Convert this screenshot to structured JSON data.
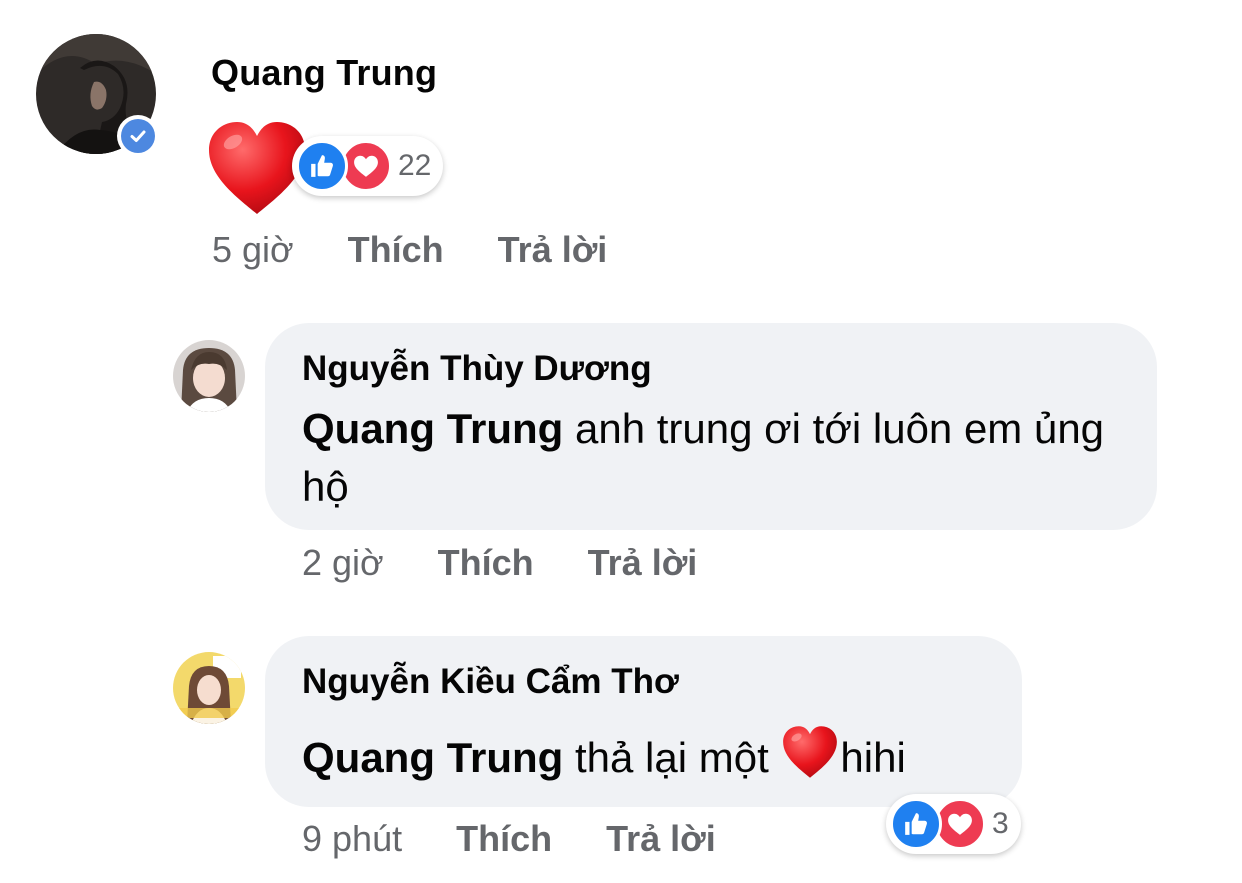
{
  "colors": {
    "text": "#050505",
    "meta": "#65676b",
    "bubble_bg": "#f0f2f5",
    "like_blue": "#1f80f0",
    "love_red": "#ee3b52",
    "verified_blue": "#4d88e0"
  },
  "comment": {
    "author": "Quang Trung",
    "verified": true,
    "content_icon": "heart-emoji",
    "reactions": {
      "icons": [
        "like-icon",
        "love-icon"
      ],
      "count": "22"
    },
    "time": "5 giờ",
    "like_label": "Thích",
    "reply_label": "Trả lời"
  },
  "replies": [
    {
      "author": "Nguyễn Thùy Dương",
      "mention": "Quang Trung",
      "text": " anh trung ơi tới luôn em ủng hộ",
      "time": "2 giờ",
      "like_label": "Thích",
      "reply_label": "Trả lời"
    },
    {
      "author": "Nguyễn Kiều Cẩm Thơ",
      "mention": "Quang Trung",
      "text_before": " thả lại một ",
      "inline_icon": "heart-emoji",
      "text_after": "hihi",
      "reactions": {
        "icons": [
          "like-icon",
          "love-icon"
        ],
        "count": "3"
      },
      "time": "9 phút",
      "like_label": "Thích",
      "reply_label": "Trả lời"
    }
  ]
}
